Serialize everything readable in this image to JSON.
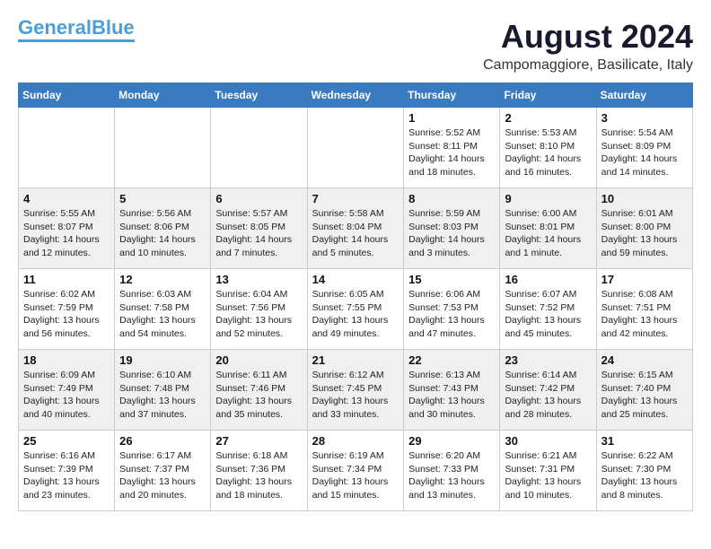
{
  "header": {
    "logo_line1": "General",
    "logo_line2": "Blue",
    "month_year": "August 2024",
    "location": "Campomaggiore, Basilicate, Italy"
  },
  "days_of_week": [
    "Sunday",
    "Monday",
    "Tuesday",
    "Wednesday",
    "Thursday",
    "Friday",
    "Saturday"
  ],
  "weeks": [
    [
      {
        "day": "",
        "info": ""
      },
      {
        "day": "",
        "info": ""
      },
      {
        "day": "",
        "info": ""
      },
      {
        "day": "",
        "info": ""
      },
      {
        "day": "1",
        "info": "Sunrise: 5:52 AM\nSunset: 8:11 PM\nDaylight: 14 hours\nand 18 minutes."
      },
      {
        "day": "2",
        "info": "Sunrise: 5:53 AM\nSunset: 8:10 PM\nDaylight: 14 hours\nand 16 minutes."
      },
      {
        "day": "3",
        "info": "Sunrise: 5:54 AM\nSunset: 8:09 PM\nDaylight: 14 hours\nand 14 minutes."
      }
    ],
    [
      {
        "day": "4",
        "info": "Sunrise: 5:55 AM\nSunset: 8:07 PM\nDaylight: 14 hours\nand 12 minutes."
      },
      {
        "day": "5",
        "info": "Sunrise: 5:56 AM\nSunset: 8:06 PM\nDaylight: 14 hours\nand 10 minutes."
      },
      {
        "day": "6",
        "info": "Sunrise: 5:57 AM\nSunset: 8:05 PM\nDaylight: 14 hours\nand 7 minutes."
      },
      {
        "day": "7",
        "info": "Sunrise: 5:58 AM\nSunset: 8:04 PM\nDaylight: 14 hours\nand 5 minutes."
      },
      {
        "day": "8",
        "info": "Sunrise: 5:59 AM\nSunset: 8:03 PM\nDaylight: 14 hours\nand 3 minutes."
      },
      {
        "day": "9",
        "info": "Sunrise: 6:00 AM\nSunset: 8:01 PM\nDaylight: 14 hours\nand 1 minute."
      },
      {
        "day": "10",
        "info": "Sunrise: 6:01 AM\nSunset: 8:00 PM\nDaylight: 13 hours\nand 59 minutes."
      }
    ],
    [
      {
        "day": "11",
        "info": "Sunrise: 6:02 AM\nSunset: 7:59 PM\nDaylight: 13 hours\nand 56 minutes."
      },
      {
        "day": "12",
        "info": "Sunrise: 6:03 AM\nSunset: 7:58 PM\nDaylight: 13 hours\nand 54 minutes."
      },
      {
        "day": "13",
        "info": "Sunrise: 6:04 AM\nSunset: 7:56 PM\nDaylight: 13 hours\nand 52 minutes."
      },
      {
        "day": "14",
        "info": "Sunrise: 6:05 AM\nSunset: 7:55 PM\nDaylight: 13 hours\nand 49 minutes."
      },
      {
        "day": "15",
        "info": "Sunrise: 6:06 AM\nSunset: 7:53 PM\nDaylight: 13 hours\nand 47 minutes."
      },
      {
        "day": "16",
        "info": "Sunrise: 6:07 AM\nSunset: 7:52 PM\nDaylight: 13 hours\nand 45 minutes."
      },
      {
        "day": "17",
        "info": "Sunrise: 6:08 AM\nSunset: 7:51 PM\nDaylight: 13 hours\nand 42 minutes."
      }
    ],
    [
      {
        "day": "18",
        "info": "Sunrise: 6:09 AM\nSunset: 7:49 PM\nDaylight: 13 hours\nand 40 minutes."
      },
      {
        "day": "19",
        "info": "Sunrise: 6:10 AM\nSunset: 7:48 PM\nDaylight: 13 hours\nand 37 minutes."
      },
      {
        "day": "20",
        "info": "Sunrise: 6:11 AM\nSunset: 7:46 PM\nDaylight: 13 hours\nand 35 minutes."
      },
      {
        "day": "21",
        "info": "Sunrise: 6:12 AM\nSunset: 7:45 PM\nDaylight: 13 hours\nand 33 minutes."
      },
      {
        "day": "22",
        "info": "Sunrise: 6:13 AM\nSunset: 7:43 PM\nDaylight: 13 hours\nand 30 minutes."
      },
      {
        "day": "23",
        "info": "Sunrise: 6:14 AM\nSunset: 7:42 PM\nDaylight: 13 hours\nand 28 minutes."
      },
      {
        "day": "24",
        "info": "Sunrise: 6:15 AM\nSunset: 7:40 PM\nDaylight: 13 hours\nand 25 minutes."
      }
    ],
    [
      {
        "day": "25",
        "info": "Sunrise: 6:16 AM\nSunset: 7:39 PM\nDaylight: 13 hours\nand 23 minutes."
      },
      {
        "day": "26",
        "info": "Sunrise: 6:17 AM\nSunset: 7:37 PM\nDaylight: 13 hours\nand 20 minutes."
      },
      {
        "day": "27",
        "info": "Sunrise: 6:18 AM\nSunset: 7:36 PM\nDaylight: 13 hours\nand 18 minutes."
      },
      {
        "day": "28",
        "info": "Sunrise: 6:19 AM\nSunset: 7:34 PM\nDaylight: 13 hours\nand 15 minutes."
      },
      {
        "day": "29",
        "info": "Sunrise: 6:20 AM\nSunset: 7:33 PM\nDaylight: 13 hours\nand 13 minutes."
      },
      {
        "day": "30",
        "info": "Sunrise: 6:21 AM\nSunset: 7:31 PM\nDaylight: 13 hours\nand 10 minutes."
      },
      {
        "day": "31",
        "info": "Sunrise: 6:22 AM\nSunset: 7:30 PM\nDaylight: 13 hours\nand 8 minutes."
      }
    ]
  ]
}
